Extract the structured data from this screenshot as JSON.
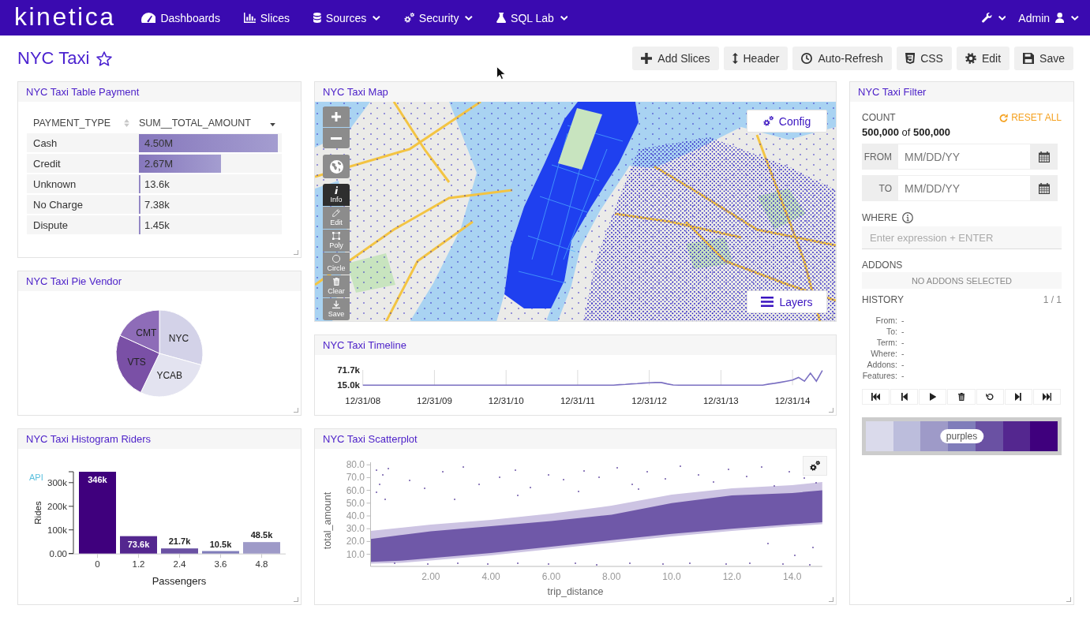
{
  "navbar": {
    "logo": "kinetica",
    "menu": [
      {
        "label": "Dashboards",
        "has_dropdown": false
      },
      {
        "label": "Slices",
        "has_dropdown": false
      },
      {
        "label": "Sources",
        "has_dropdown": true
      },
      {
        "label": "Security",
        "has_dropdown": true
      },
      {
        "label": "SQL Lab",
        "has_dropdown": true
      }
    ],
    "user": "Admin"
  },
  "dashboard": {
    "title": "NYC Taxi",
    "starred": false,
    "actions": [
      "Add Slices",
      "Header",
      "Auto-Refresh",
      "CSS",
      "Edit",
      "Save"
    ]
  },
  "payment_table": {
    "title": "NYC Taxi Table Payment",
    "columns": [
      {
        "label": "PAYMENT_TYPE",
        "sorted": false
      },
      {
        "label": "SUM__TOTAL_AMOUNT",
        "sorted": true
      }
    ],
    "rows": [
      {
        "payment_type": "Cash",
        "amount": "4.50M",
        "level": 1.0
      },
      {
        "payment_type": "Credit",
        "amount": "2.67M",
        "level": 0.593
      },
      {
        "payment_type": "Unknown",
        "amount": "13.6k",
        "level": 0.003
      },
      {
        "payment_type": "No Charge",
        "amount": "7.38k",
        "level": 0.0016
      },
      {
        "payment_type": "Dispute",
        "amount": "1.45k",
        "level": 0.0003
      }
    ]
  },
  "vendor_pie": {
    "title": "NYC Taxi Pie Vendor",
    "chart_data": {
      "type": "pie",
      "categories": [
        "NYC",
        "YCAB",
        "VTS",
        "CMT"
      ],
      "values": [
        29.3,
        27.8,
        24.7,
        18.2
      ],
      "colors": [
        "#d3d2e8",
        "#e3e3f0",
        "#7a50a6",
        "#8e6cb8"
      ]
    }
  },
  "riders_histogram": {
    "title": "NYC Taxi Histogram Riders",
    "api_link": "API",
    "chart_data": {
      "type": "bar",
      "xlabel": "Passengers",
      "ylabel": "Rides",
      "categories": [
        "0",
        "1.2",
        "2.4",
        "3.6",
        "4.8"
      ],
      "values": [
        346000,
        73600,
        21700,
        10500,
        48500
      ],
      "colors": [
        "#3f007d",
        "#54278f",
        "#6a51a3",
        "#807dba",
        "#9e9ac8"
      ],
      "value_labels": [
        "346k",
        "73.6k",
        "21.7k",
        "10.5k",
        "48.5k"
      ],
      "ylim": [
        0,
        346000
      ],
      "yticks": [
        {
          "value": 0,
          "label": "0.00"
        },
        {
          "value": 100000,
          "label": "100k"
        },
        {
          "value": 200000,
          "label": "200k"
        },
        {
          "value": 300000,
          "label": "300k"
        }
      ]
    }
  },
  "map": {
    "title": "NYC Taxi Map",
    "tools": [
      {
        "label": "Info",
        "selected": true
      },
      {
        "label": "Edit",
        "selected": false
      },
      {
        "label": "Poly",
        "selected": false
      },
      {
        "label": "Circle",
        "selected": false
      },
      {
        "label": "Clear",
        "selected": false
      },
      {
        "label": "Save",
        "selected": false
      }
    ],
    "config_button": "Config",
    "layers_button": "Layers"
  },
  "timeline": {
    "title": "NYC Taxi Timeline",
    "chart_data": {
      "type": "line",
      "categories": [
        "12/31/08",
        null,
        null,
        null,
        null,
        null,
        null,
        null,
        null,
        null,
        null,
        null,
        "12/31/09",
        null,
        null,
        null,
        null,
        null,
        null,
        null,
        null,
        null,
        null,
        null,
        "12/31/10",
        null,
        null,
        null,
        null,
        null,
        null,
        null,
        null,
        null,
        null,
        null,
        "12/31/11",
        null,
        null,
        null,
        null,
        null,
        null,
        null,
        null,
        null,
        null,
        null,
        "12/31/12",
        null,
        null,
        null,
        null,
        null,
        null,
        null,
        null,
        null,
        null,
        null,
        "12/31/13",
        null,
        null,
        null,
        null,
        null,
        null,
        null,
        null,
        null,
        null,
        null,
        "12/31/14",
        null,
        null,
        null,
        null,
        null
      ],
      "series": [
        {
          "color": "#7b70c2",
          "values": [
            15000,
            15000,
            15000,
            15000,
            15000,
            15000,
            15000,
            15000,
            15000,
            15000,
            15000,
            15000,
            15000,
            15000,
            15000,
            15000,
            15000,
            15000,
            15000,
            15000,
            15000,
            15000,
            15000,
            15000,
            15000,
            15000,
            15000,
            15000,
            15000,
            15000,
            15000,
            15000,
            15000,
            15000,
            15000,
            15000,
            15000,
            15000,
            15000,
            15000,
            15000,
            15000,
            15000,
            17000,
            18000,
            20000,
            21000,
            23000,
            24000,
            25000,
            25000,
            20000,
            16000,
            15000,
            15000,
            15000,
            15000,
            15000,
            15000,
            15000,
            15000,
            15000,
            15000,
            15000,
            15000,
            15000,
            15000,
            15000,
            19000,
            22000,
            26000,
            30000,
            34000,
            44000,
            30000,
            60000,
            30000,
            70000
          ]
        }
      ],
      "ylim": [
        15000,
        71700
      ],
      "yticks": [
        {
          "value": 15000,
          "label": "15.0k"
        },
        {
          "value": 71700,
          "label": "71.7k"
        }
      ]
    }
  },
  "scatterplot": {
    "title": "NYC Taxi Scatterplot",
    "chart_data": {
      "type": "scatter",
      "xlabel": "trip_distance",
      "ylabel": "total_amount",
      "xlim": [
        0,
        15
      ],
      "ylim": [
        0.5,
        82
      ],
      "xticks": [
        {
          "value": 2,
          "label": "2.00"
        },
        {
          "value": 4,
          "label": "4.00"
        },
        {
          "value": 6,
          "label": "6.00"
        },
        {
          "value": 8,
          "label": "8.00"
        },
        {
          "value": 10,
          "label": "10.0"
        },
        {
          "value": 12,
          "label": "12.0"
        },
        {
          "value": 14,
          "label": "14.0"
        }
      ],
      "yticks": [
        {
          "value": 10,
          "label": "10.0"
        },
        {
          "value": 20,
          "label": "20.0"
        },
        {
          "value": 30,
          "label": "30.0"
        },
        {
          "value": 40,
          "label": "40.0"
        },
        {
          "value": 50,
          "label": "50.0"
        },
        {
          "value": 60,
          "label": "60.0"
        },
        {
          "value": 70,
          "label": "70.0"
        },
        {
          "value": 80,
          "label": "80.0"
        }
      ]
    }
  },
  "filter": {
    "title": "NYC Taxi Filter",
    "count_label": "COUNT",
    "reset_button": "RESET ALL",
    "count_text": "**500,000** of **500,000**",
    "date_fields": [
      {
        "label": "FROM",
        "placeholder": "MM/DD/YY"
      },
      {
        "label": "TO",
        "placeholder": "MM/DD/YY"
      }
    ],
    "where_label": "WHERE",
    "where_field": {
      "placeholder": "Enter expression + ENTER"
    },
    "addons_label": "ADDONS",
    "addons_empty": "NO ADDONS SELECTED",
    "history_label": "HISTORY",
    "history_position": "1 / 1",
    "history_details": [
      {
        "label": "From:",
        "value": "-"
      },
      {
        "label": "To:",
        "value": "-"
      },
      {
        "label": "Term:",
        "value": "-"
      },
      {
        "label": "Where:",
        "value": "-"
      },
      {
        "label": "Addons:",
        "value": "-"
      },
      {
        "label": "Features:",
        "value": "-"
      }
    ],
    "palette": {
      "name": "purples",
      "swatches": [
        {
          "color": "#dadaeb"
        },
        {
          "color": "#bcbddc"
        },
        {
          "color": "#9e9ac8"
        },
        {
          "color": "#807dba"
        },
        {
          "color": "#6a51a3"
        },
        {
          "color": "#54278f"
        },
        {
          "color": "#3f007d"
        }
      ]
    }
  }
}
